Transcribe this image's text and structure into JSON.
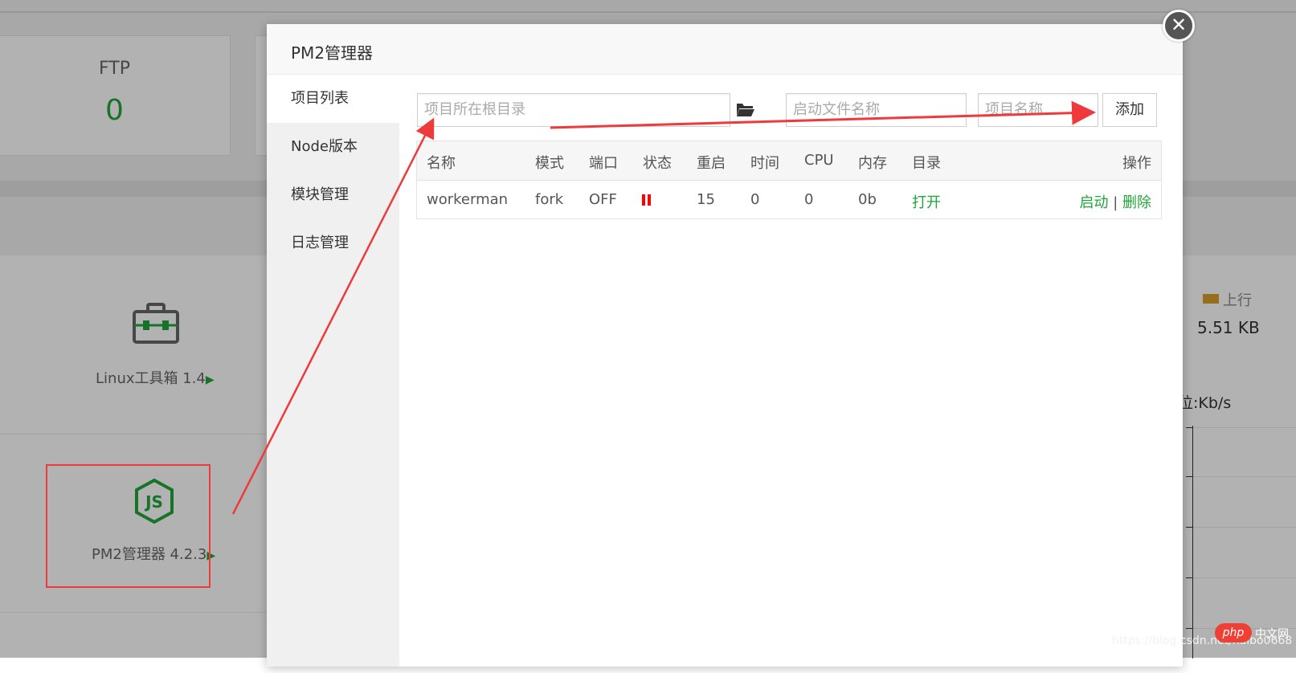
{
  "background": {
    "stat_cards": [
      {
        "title": "FTP",
        "value": "0"
      }
    ],
    "plugins": [
      {
        "label": "Linux工具箱 1.4",
        "icon": "toolbox-icon"
      },
      {
        "label": "PM2管理器 4.2.3",
        "icon": "nodejs-icon"
      }
    ],
    "traffic": {
      "legend_upload": "上行",
      "upload_value": "5.51 KB",
      "unit_label": "位:Kb/s"
    },
    "watermark": "https://blog.csdn.net/haibo0668",
    "php_logo": "php",
    "php_cn": "中文网"
  },
  "modal": {
    "title": "PM2管理器",
    "close_icon": "close-icon",
    "sidebar": [
      {
        "label": "项目列表",
        "active": true
      },
      {
        "label": "Node版本",
        "active": false
      },
      {
        "label": "模块管理",
        "active": false
      },
      {
        "label": "日志管理",
        "active": false
      }
    ],
    "form": {
      "root_dir_placeholder": "项目所在根目录",
      "folder_icon": "folder-open-icon",
      "start_file_placeholder": "启动文件名称",
      "project_name_placeholder": "项目名称",
      "add_label": "添加"
    },
    "table": {
      "headers": [
        "名称",
        "模式",
        "端口",
        "状态",
        "重启",
        "时间",
        "CPU",
        "内存",
        "目录",
        "操作"
      ],
      "rows": [
        {
          "name": "workerman",
          "mode": "fork",
          "port": "OFF",
          "status_icon": "pause-icon",
          "restarts": "15",
          "time": "0",
          "cpu": "0",
          "memory": "0b",
          "dir_action": "打开",
          "start_action": "启动",
          "separator": "|",
          "delete_action": "删除"
        }
      ]
    }
  },
  "colors": {
    "accent_green": "#20a53a",
    "annotation_red": "#ee3a3a",
    "status_red": "#ff0000"
  }
}
